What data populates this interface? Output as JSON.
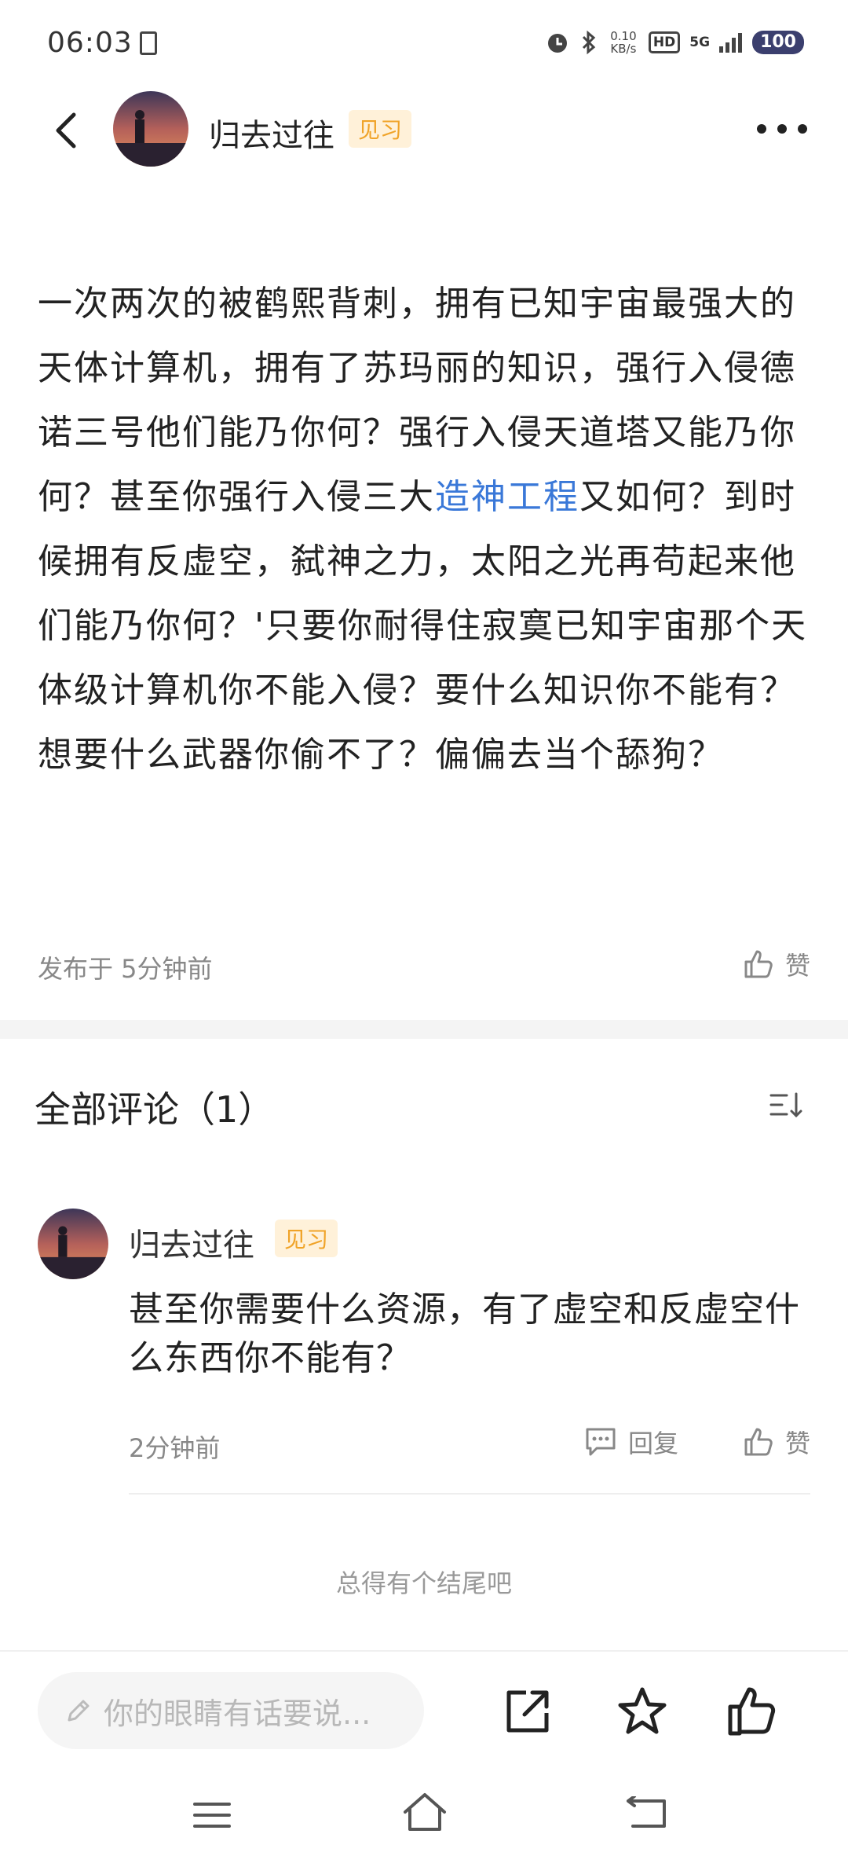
{
  "status_bar": {
    "time": "06:03",
    "net_speed_value": "0.10",
    "net_speed_unit": "KB/s",
    "hd": "HD",
    "network": "5G",
    "battery": "100"
  },
  "header": {
    "user_name": "归去过往",
    "level_badge": "见习"
  },
  "post": {
    "text_before_link": "一次两次的被鹤熙背刺，拥有已知宇宙最强大的天体计算机，拥有了苏玛丽的知识，强行入侵德诺三号他们能乃你何？强行入侵天道塔又能乃你何？甚至你强行入侵三大",
    "link_text": "造神工程",
    "text_after_link": "又如何？到时候拥有反虚空，弑神之力，太阳之光再苟起来他们能乃你何？'只要你耐得住寂寞已知宇宙那个天体级计算机你不能入侵？要什么知识你不能有？想要什么武器你偷不了？偏偏去当个舔狗？",
    "published": "发布于 5分钟前",
    "like_label": "赞"
  },
  "comments_section": {
    "title": "全部评论（1）",
    "comments": [
      {
        "user_name": "归去过往",
        "level_badge": "见习",
        "text": "甚至你需要什么资源，有了虚空和反虚空什么东西你不能有？",
        "time": "2分钟前",
        "reply_label": "回复",
        "like_label": "赞"
      }
    ],
    "end_text": "总得有个结尾吧"
  },
  "bottom_bar": {
    "input_placeholder": "你的眼睛有话要说..."
  },
  "colors": {
    "link": "#3a78d8",
    "badge_bg": "#fff1d9",
    "badge_text": "#f0a328",
    "muted_text": "#888888"
  }
}
